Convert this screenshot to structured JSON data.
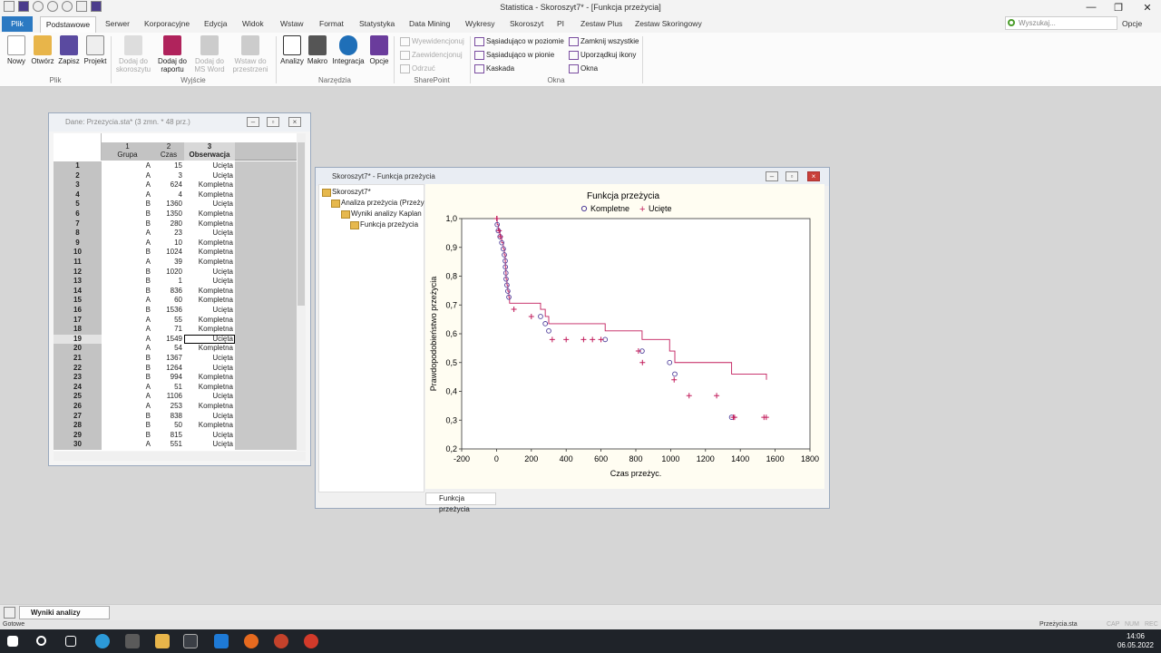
{
  "window": {
    "title": "Statistica - Skoroszyt7* - [Funkcja przeżycia]",
    "minimize_glyph": "—",
    "restore_glyph": "❐",
    "close_glyph": "✕"
  },
  "tabs": {
    "file": "Plik",
    "items": [
      "Podstawowe",
      "Serwer",
      "Korporacyjne",
      "Edycja",
      "Widok",
      "Wstaw",
      "Format",
      "Statystyka",
      "Data Mining",
      "Wykresy",
      "Skoroszyt",
      "PI",
      "Zestaw Plus",
      "Zestaw Skoringowy"
    ],
    "search_placeholder": "Wyszukaj...",
    "options": "Opcje"
  },
  "ribbon": {
    "new": "Nowy",
    "open": "Otwórz",
    "save": "Zapisz",
    "project": "Projekt",
    "group_file": "Plik",
    "add_workbook": "Dodaj do skoroszytu",
    "add_report": "Dodaj do raportu",
    "add_msword": "Dodaj do MS Word",
    "paste_space": "Wstaw do przestrzeni",
    "group_output": "Wyjście",
    "analyses": "Analizy",
    "macro": "Makro",
    "integration": "Integracja",
    "options": "Opcje",
    "group_tools": "Narzędzia",
    "checkin": "Wyewidencjonuj",
    "checkout": "Zaewidencjonuj",
    "discard": "Odrzuć",
    "group_sharepoint": "SharePoint",
    "tile_h": "Sąsiadująco w poziomie",
    "tile_v": "Sąsiadująco w pionie",
    "cascade": "Kaskada",
    "close_all": "Zamknij wszystkie",
    "arrange_icons": "Uporządkuj ikony",
    "windows": "Okna",
    "group_windows": "Okna"
  },
  "datawin": {
    "title": "Dane: Przezycia.sta* (3 zmn. * 48 prz.)",
    "headers": [
      {
        "num": "1",
        "name": "Grupa"
      },
      {
        "num": "2",
        "name": "Czas"
      },
      {
        "num": "3",
        "name": "Obserwacja"
      }
    ],
    "rows": [
      [
        "1",
        "A",
        "15",
        "Ucięta"
      ],
      [
        "2",
        "A",
        "3",
        "Ucięta"
      ],
      [
        "3",
        "A",
        "624",
        "Kompletna"
      ],
      [
        "4",
        "A",
        "4",
        "Kompletna"
      ],
      [
        "5",
        "B",
        "1360",
        "Ucięta"
      ],
      [
        "6",
        "B",
        "1350",
        "Kompletna"
      ],
      [
        "7",
        "B",
        "280",
        "Kompletna"
      ],
      [
        "8",
        "A",
        "23",
        "Ucięta"
      ],
      [
        "9",
        "A",
        "10",
        "Kompletna"
      ],
      [
        "10",
        "B",
        "1024",
        "Kompletna"
      ],
      [
        "11",
        "A",
        "39",
        "Kompletna"
      ],
      [
        "12",
        "B",
        "1020",
        "Ucięta"
      ],
      [
        "13",
        "B",
        "1",
        "Ucięta"
      ],
      [
        "14",
        "B",
        "836",
        "Kompletna"
      ],
      [
        "15",
        "A",
        "60",
        "Kompletna"
      ],
      [
        "16",
        "B",
        "1536",
        "Ucięta"
      ],
      [
        "17",
        "A",
        "55",
        "Kompletna"
      ],
      [
        "18",
        "A",
        "71",
        "Kompletna"
      ],
      [
        "19",
        "A",
        "1549",
        "Ucięta"
      ],
      [
        "20",
        "A",
        "54",
        "Kompletna"
      ],
      [
        "21",
        "B",
        "1367",
        "Ucięta"
      ],
      [
        "22",
        "B",
        "1264",
        "Ucięta"
      ],
      [
        "23",
        "B",
        "994",
        "Kompletna"
      ],
      [
        "24",
        "A",
        "51",
        "Kompletna"
      ],
      [
        "25",
        "A",
        "1106",
        "Ucięta"
      ],
      [
        "26",
        "A",
        "253",
        "Kompletna"
      ],
      [
        "27",
        "B",
        "838",
        "Ucięta"
      ],
      [
        "28",
        "B",
        "50",
        "Kompletna"
      ],
      [
        "29",
        "B",
        "815",
        "Ucięta"
      ],
      [
        "30",
        "A",
        "551",
        "Ucięta"
      ]
    ]
  },
  "workbook": {
    "title": "Skoroszyt7* - Funkcja przeżycia",
    "tree": [
      "Skoroszyt7*",
      "Analiza przeżycia (Przeży",
      "Wyniki analizy Kaplan",
      "Funkcja przeżycia"
    ],
    "tab": "Funkcja przeżycia"
  },
  "chart_data": {
    "type": "line",
    "title": "Funkcja przeżycia",
    "xlabel": "Czas przeżyc.",
    "ylabel": "Prawdopodobieństwo przeżycia",
    "xlim": [
      -200,
      1800
    ],
    "ylim": [
      0.2,
      1.0
    ],
    "xticks": [
      "-200",
      "0",
      "200",
      "400",
      "600",
      "800",
      "1000",
      "1200",
      "1400",
      "1600",
      "1800"
    ],
    "yticks": [
      "0,2",
      "0,3",
      "0,4",
      "0,5",
      "0,6",
      "0,7",
      "0,8",
      "0,9",
      "1,0"
    ],
    "legend": {
      "complete": "Kompletne",
      "censored": "Ucięte",
      "placement": "top"
    },
    "grid": false,
    "color": "#c21d5c",
    "step": {
      "x": [
        0,
        4,
        10,
        20,
        30,
        39,
        45,
        50,
        51,
        54,
        55,
        60,
        65,
        71,
        75,
        253,
        280,
        300,
        624,
        836,
        994,
        1024,
        1350,
        1550
      ],
      "y": [
        1.0,
        0.979,
        0.958,
        0.937,
        0.916,
        0.895,
        0.874,
        0.853,
        0.832,
        0.811,
        0.79,
        0.769,
        0.748,
        0.727,
        0.706,
        0.685,
        0.66,
        0.635,
        0.61,
        0.58,
        0.54,
        0.5,
        0.46,
        0.44
      ]
    },
    "complete_points": {
      "x": [
        4,
        10,
        20,
        30,
        39,
        45,
        50,
        51,
        54,
        55,
        60,
        65,
        71,
        253,
        280,
        300,
        624,
        836,
        994,
        1024,
        1350
      ],
      "y": [
        0.979,
        0.958,
        0.937,
        0.916,
        0.895,
        0.874,
        0.853,
        0.832,
        0.811,
        0.79,
        0.769,
        0.748,
        0.727,
        0.66,
        0.635,
        0.61,
        0.58,
        0.54,
        0.5,
        0.46,
        0.31
      ]
    },
    "censored_points": {
      "x": [
        1,
        3,
        15,
        23,
        100,
        200,
        320,
        400,
        500,
        551,
        600,
        815,
        838,
        1020,
        1106,
        1264,
        1360,
        1367,
        1536,
        1549
      ],
      "y": [
        1.0,
        1.0,
        0.958,
        0.937,
        0.685,
        0.66,
        0.58,
        0.58,
        0.58,
        0.58,
        0.58,
        0.54,
        0.5,
        0.44,
        0.385,
        0.385,
        0.31,
        0.31,
        0.31,
        0.31
      ]
    }
  },
  "docbar": {
    "tab": "Wyniki analizy Kaplan..."
  },
  "status": {
    "left": "Gotowe",
    "file": "Przeżycia.sta",
    "keys": [
      "CAP",
      "NUM",
      "REC"
    ]
  },
  "taskbar": {
    "time": "14:06",
    "date": "06.05.2022"
  }
}
